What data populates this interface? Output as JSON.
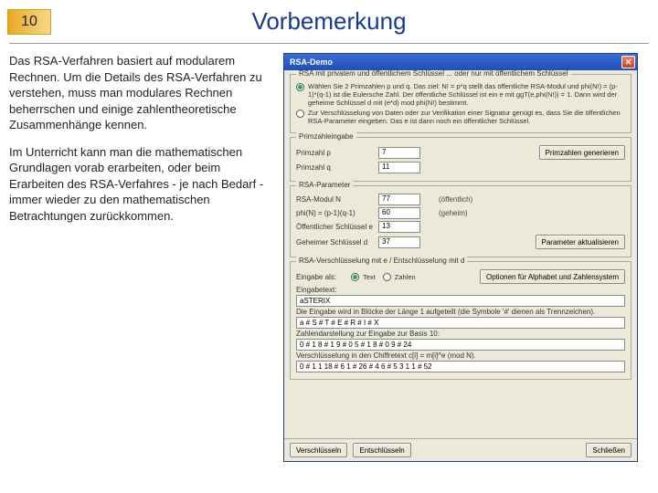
{
  "slideNumber": "10",
  "title": "Vorbemerkung",
  "para1": "Das RSA-Verfahren basiert auf modularem Rechnen. Um die Details des RSA-Verfahren zu verstehen, muss man modulares Rechnen beherrschen und einige zahlentheoretische Zusammenhänge kennen.",
  "para2": "Im Unterricht kann man die mathematischen Grundlagen vorab erarbeiten, oder beim Erarbeiten des RSA-Verfahres - je nach Bedarf - immer wieder zu den mathematischen Betrachtungen zurückkommen.",
  "dialog": {
    "title": "RSA-Demo",
    "group1": {
      "title": "RSA mit privatem und öffentlichem Schlüssel ... oder nur mit öffentlichem Schlüssel",
      "opt1": "Wählen Sie 2 Primzahlen p und q. Das ziel: N! = p*q stellt das öffentliche RSA-Modul und phi(N!) = (p-1)*(q-1) ist die Eulersche Zahl. Der öffentliche Schlüssel ist ein e mit ggT(e,phi(N!)) = 1. Dann wird der geheime Schlüssel d mit (e*d) mod phi(N!) bestimmt.",
      "opt2": "Zur Verschlüsselung von Daten oder zur Verifikation einer Signatur genügt es, dass Sie die öffentlichen RSA-Parameter eingeben. Das e ist dann noch ein öffentlicher Schlüssel."
    },
    "group2": {
      "title": "Primzahleingabe",
      "pLabel": "Primzahl p",
      "pVal": "7",
      "qLabel": "Primzahl q",
      "qVal": "11",
      "genBtn": "Primzahlen generieren"
    },
    "group3": {
      "title": "RSA-Parameter",
      "modLabel": "RSA-Modul N",
      "modVal": "77",
      "modNote": "(öffentlich)",
      "phiLabel": "phi(N) = (p-1)(q-1)",
      "phiVal": "60",
      "phiNote": "(geheim)",
      "pubLabel": "Öffentlicher Schlüssel e",
      "pubVal": "13",
      "privLabel": "Geheimer Schlüssel d",
      "privVal": "37",
      "updBtn": "Parameter aktualisieren"
    },
    "group4": {
      "title": "RSA-Verschlüsselung mit e / Entschlüsselung mit d",
      "inAsLabel": "Eingabe als:",
      "inText": "Text",
      "inNum": "Zahlen",
      "alphaBtn": "Optionen für Alphabet und Zahlensystem",
      "inTextLabel": "Eingabetext:",
      "inVal": "aSTERIX",
      "blocksLabel": "Die Eingabe wird in Blöcke der Länge 1 aufgeteilt (die Symbole '#' dienen als Trennzeichen).",
      "blocksVal": "a # S # T # E # R # I # X",
      "encLabel": "Zahlendarstellung zur Eingabe zur Basis 10:",
      "encVal": "0 # 1 8 # 1 9 # 0 5 #  1 8 #  0 9 # 24",
      "cipherLabel": "Verschlüsselung in den Chiffretext c[i] = m[i]^e (mod N).",
      "cipherVal": "0 # 1 1 18 # 6 1 # 26 # 4 6 # 5 3 1 1 # 52"
    },
    "buttons": {
      "encrypt": "Verschlüsseln",
      "decrypt": "Entschlüsseln",
      "close": "Schließen"
    }
  }
}
